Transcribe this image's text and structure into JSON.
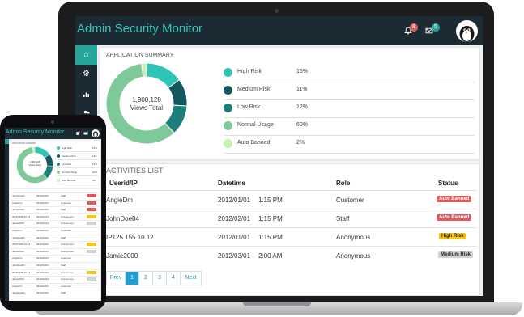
{
  "app": {
    "title": "Admin Security Monitor"
  },
  "header": {
    "notifications_count": "8",
    "messages_count": "5",
    "bell_icon": "bell-icon",
    "mail_icon": "envelope-icon",
    "avatar_icon": "penguin-avatar"
  },
  "sidebar": {
    "items": [
      {
        "icon": "home-icon",
        "glyph": "⌂",
        "active": true
      },
      {
        "icon": "gear-icon",
        "glyph": "⚙",
        "active": false
      },
      {
        "icon": "bar-chart-icon",
        "glyph": "▮",
        "active": false
      },
      {
        "icon": "users-icon",
        "glyph": "👤",
        "active": false
      }
    ]
  },
  "summary": {
    "title": "APPLICATION SUMMARY",
    "center_value": "1,900,128",
    "center_label": "Views Total",
    "legend": [
      {
        "name": "High Risk",
        "pct": "15%",
        "value": 15,
        "color": "#2ec4b6"
      },
      {
        "name": "Medium Risk",
        "pct": "11%",
        "value": 11,
        "color": "#135a60"
      },
      {
        "name": "Low Risk",
        "pct": "12%",
        "value": 12,
        "color": "#1d7f7a"
      },
      {
        "name": "Normal Usage",
        "pct": "60%",
        "value": 60,
        "color": "#7ec99a"
      },
      {
        "name": "Auto Banned",
        "pct": "2%",
        "value": 2,
        "color": "#c9efb3"
      }
    ]
  },
  "activities": {
    "title": "ACTIVITIES LIST",
    "columns": [
      "Userid/IP",
      "Datetime",
      "Role",
      "Status"
    ],
    "rows": [
      {
        "user": "AngieDm",
        "date": "2012/01/01",
        "time": "1:15 PM",
        "role": "Customer",
        "status": "Auto Banned",
        "status_type": "red"
      },
      {
        "user": "JohnDoe84",
        "date": "2012/02/01",
        "time": "1:15 PM",
        "role": "Staff",
        "status": "Auto Banned",
        "status_type": "red"
      },
      {
        "user": "IP125.155.10.12",
        "date": "2012/01/01",
        "time": "1:15 PM",
        "role": "Anonymous",
        "status": "High Risk",
        "status_type": "yellow"
      },
      {
        "user": "Jamie2000",
        "date": "2012/03/01",
        "time": "2:00 AM",
        "role": "Anonymous",
        "status": "Medium Risk",
        "status_type": "gray"
      }
    ],
    "pager": {
      "prev": "Prev",
      "pages": [
        "1",
        "2",
        "3",
        "4"
      ],
      "active_page": "1",
      "next": "Next"
    }
  },
  "phone": {
    "title": "Admin Security Monitor",
    "summary_label": "APPLICATION SUMMARY",
    "center_value": "1,900,128",
    "center_label": "Views Total",
    "legend": [
      {
        "name": "High Risk",
        "pct": "15%"
      },
      {
        "name": "Medium Risk",
        "pct": "11%"
      },
      {
        "name": "Low Risk",
        "pct": "12%"
      },
      {
        "name": "Normal Usage",
        "pct": "60%"
      },
      {
        "name": "Auto Banned",
        "pct": "2%"
      }
    ],
    "rows": [
      {
        "user": "JohnDoeB4",
        "date": "2012/01/01",
        "role": "Staff",
        "status": "red"
      },
      {
        "user": "AngieDm",
        "date": "2012/01/01",
        "role": "Customer",
        "status": "red"
      },
      {
        "user": "JohnDoeB4",
        "date": "2012/02/01",
        "role": "Staff",
        "status": "red"
      },
      {
        "user": "IP125.155.10.12",
        "date": "2012/01/01",
        "role": "Anonymous",
        "status": "yellow"
      },
      {
        "user": "Jamie2000",
        "date": "2012/01/01",
        "role": "Anonymous",
        "status": "gray"
      },
      {
        "user": "AngieDm",
        "date": "2012/01/01",
        "role": "Customer",
        "status": "none"
      },
      {
        "user": "JohnDoeB4",
        "date": "2012/01/01",
        "role": "Staff",
        "status": "none"
      },
      {
        "user": "IP125.155.10.12",
        "date": "2012/01/01",
        "role": "Anonymous",
        "status": "yellow"
      },
      {
        "user": "Jamie2000",
        "date": "2012/01/01",
        "role": "Anonymous",
        "status": "gray"
      },
      {
        "user": "AngieDm",
        "date": "2012/01/01",
        "role": "Customer",
        "status": "none"
      },
      {
        "user": "JohnDoeB4",
        "date": "2012/01/01",
        "role": "Staff",
        "status": "none"
      },
      {
        "user": "IP125.155.10.12",
        "date": "2012/01/01",
        "role": "Anonymous",
        "status": "yellow"
      },
      {
        "user": "Jamie2000",
        "date": "2012/01/01",
        "role": "Anonymous",
        "status": "gray"
      },
      {
        "user": "AngieDm",
        "date": "2012/01/01",
        "role": "Customer",
        "status": "none"
      },
      {
        "user": "JohnDoeB4",
        "date": "2012/01/01",
        "role": "Staff",
        "status": "none"
      }
    ]
  }
}
